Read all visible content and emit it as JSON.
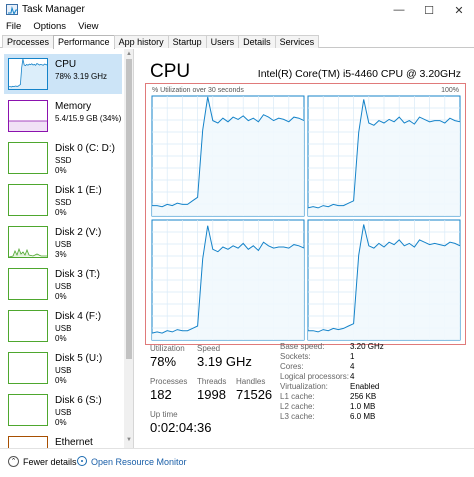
{
  "window": {
    "title": "Task Manager",
    "min": "—",
    "max": "☐",
    "close": "✕"
  },
  "menu": [
    "File",
    "Options",
    "View"
  ],
  "tabs": [
    "Processes",
    "Performance",
    "App history",
    "Startup",
    "Users",
    "Details",
    "Services"
  ],
  "active_tab": "Performance",
  "colors": {
    "cpu": "#1583c9",
    "memory": "#8b12ae",
    "disk": "#4ea72e",
    "ethernet": "#a74f01",
    "graph_fill": "#f1f8fd",
    "grid": "#d9eaf7",
    "selected": "#cce4f7",
    "highlight_box": "#e07a7a",
    "link": "#1a5fa8"
  },
  "sidebar": [
    {
      "name": "CPU",
      "sub": "78%  3.19 GHz",
      "kind": "cpu",
      "selected": true
    },
    {
      "name": "Memory",
      "sub": "5.4/15.9 GB (34%)",
      "kind": "memory"
    },
    {
      "name": "Disk 0 (C: D:)",
      "sub": "SSD",
      "sub2": "0%",
      "kind": "disk"
    },
    {
      "name": "Disk 1 (E:)",
      "sub": "SSD",
      "sub2": "0%",
      "kind": "disk"
    },
    {
      "name": "Disk 2 (V:)",
      "sub": "USB",
      "sub2": "3%",
      "kind": "disk",
      "activity": true
    },
    {
      "name": "Disk 3 (T:)",
      "sub": "USB",
      "sub2": "0%",
      "kind": "disk"
    },
    {
      "name": "Disk 4 (F:)",
      "sub": "USB",
      "sub2": "0%",
      "kind": "disk"
    },
    {
      "name": "Disk 5 (U:)",
      "sub": "USB",
      "sub2": "0%",
      "kind": "disk"
    },
    {
      "name": "Disk 6 (S:)",
      "sub": "USB",
      "sub2": "0%",
      "kind": "disk"
    },
    {
      "name": "Ethernet",
      "sub": "",
      "kind": "ethernet"
    }
  ],
  "main": {
    "title": "CPU",
    "model": "Intel(R) Core(TM) i5-4460 CPU @ 3.20GHz",
    "graph_caption": "% Utilization over 30 seconds",
    "graph_max": "100%"
  },
  "chart_data": {
    "type": "line",
    "title": "% Utilization over 30 seconds",
    "ylim": [
      0,
      100
    ],
    "grid": true,
    "x": [
      0,
      1,
      2,
      3,
      4,
      5,
      6,
      7,
      8,
      9,
      10,
      11,
      12,
      13,
      14,
      15,
      16,
      17,
      18,
      19,
      20,
      21,
      22,
      23,
      24,
      25,
      26,
      27,
      28,
      29,
      30
    ],
    "series": [
      {
        "values": [
          8,
          8,
          7,
          9,
          8,
          10,
          9,
          9,
          12,
          15,
          72,
          100,
          80,
          78,
          82,
          79,
          83,
          81,
          84,
          80,
          82,
          79,
          85,
          83,
          80,
          82,
          81,
          79,
          83,
          82,
          80
        ]
      },
      {
        "values": [
          6,
          7,
          6,
          8,
          7,
          9,
          8,
          8,
          10,
          12,
          70,
          98,
          78,
          76,
          80,
          78,
          81,
          79,
          83,
          78,
          80,
          77,
          83,
          81,
          79,
          80,
          80,
          78,
          82,
          80,
          79
        ]
      },
      {
        "values": [
          5,
          6,
          5,
          7,
          6,
          8,
          7,
          7,
          9,
          11,
          68,
          96,
          76,
          74,
          78,
          76,
          79,
          77,
          81,
          76,
          79,
          75,
          82,
          79,
          77,
          78,
          78,
          77,
          80,
          79,
          77
        ]
      },
      {
        "values": [
          7,
          7,
          6,
          8,
          7,
          9,
          8,
          9,
          11,
          13,
          71,
          97,
          79,
          77,
          81,
          78,
          82,
          80,
          84,
          79,
          81,
          78,
          84,
          82,
          80,
          81,
          80,
          79,
          82,
          81,
          79
        ]
      }
    ]
  },
  "stats": {
    "utilization_label": "Utilization",
    "utilization": "78%",
    "speed_label": "Speed",
    "speed": "3.19 GHz",
    "processes_label": "Processes",
    "processes": "182",
    "threads_label": "Threads",
    "threads": "1998",
    "handles_label": "Handles",
    "handles": "71526",
    "uptime_label": "Up time",
    "uptime": "0:02:04:36"
  },
  "specs": [
    {
      "key": "Base speed:",
      "value": "3.20 GHz"
    },
    {
      "key": "Sockets:",
      "value": "1"
    },
    {
      "key": "Cores:",
      "value": "4"
    },
    {
      "key": "Logical processors:",
      "value": "4"
    },
    {
      "key": "Virtualization:",
      "value": "Enabled"
    },
    {
      "key": "L1 cache:",
      "value": "256 KB"
    },
    {
      "key": "L2 cache:",
      "value": "1.0 MB"
    },
    {
      "key": "L3 cache:",
      "value": "6.0 MB"
    }
  ],
  "footer": {
    "fewer_details": "Fewer details",
    "open_monitor": "Open Resource Monitor"
  }
}
